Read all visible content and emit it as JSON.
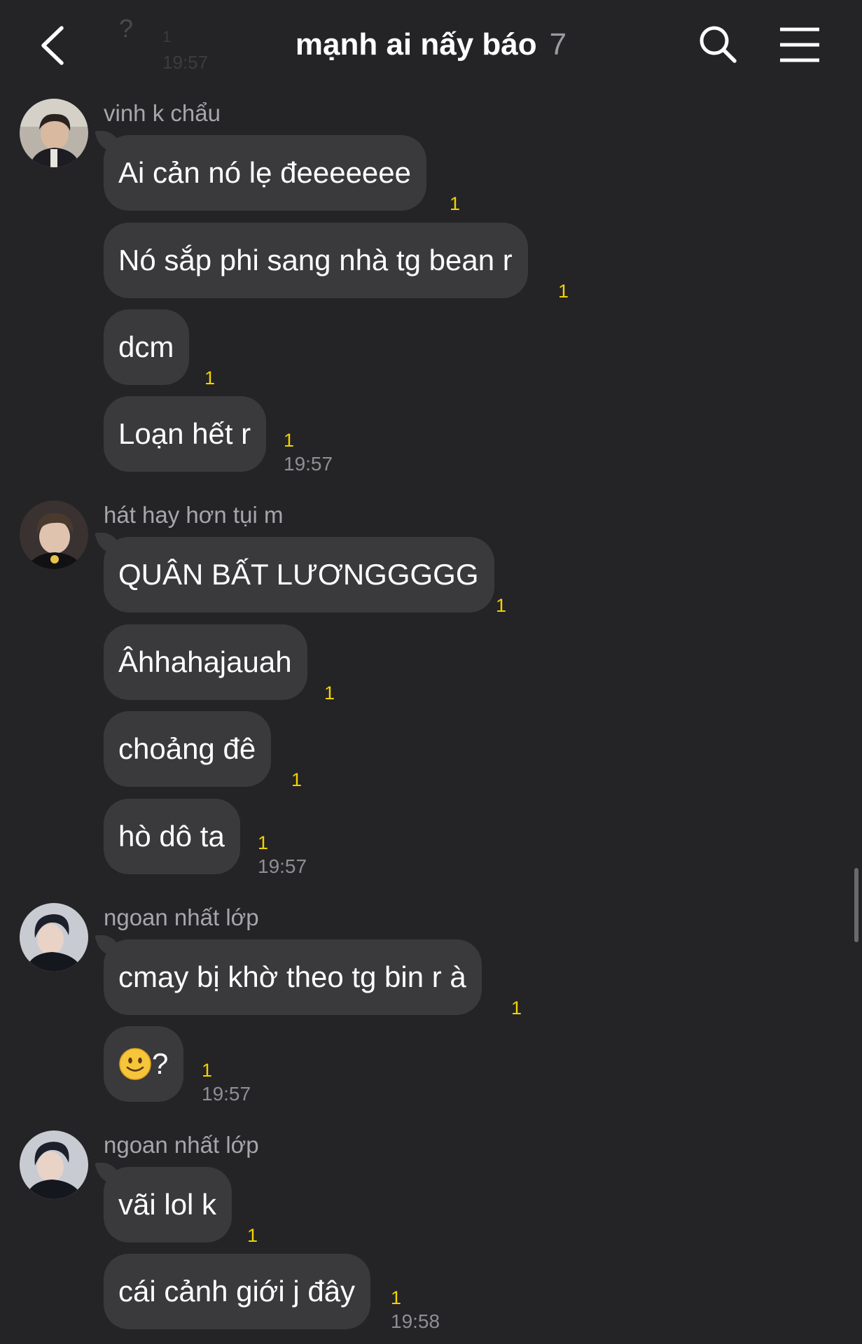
{
  "header": {
    "title": "mạnh ai nấy báo",
    "member_count": "7",
    "ghost_text": "?",
    "ghost_count": "1",
    "ghost_time": "19:57"
  },
  "colors": {
    "background": "#242426",
    "bubble": "#3a3a3d",
    "unread_count": "#f2d200",
    "timestamp": "#8e8e93",
    "sender_name": "#a6a6ab"
  },
  "groups": [
    {
      "sender": "vinh k chẩu",
      "messages": [
        {
          "text": "Ai cản nó lẹ đeeeeeee",
          "count": "1"
        },
        {
          "text": "Nó sắp phi sang nhà tg bean r",
          "count": "1"
        },
        {
          "text": "dcm",
          "count": "1"
        },
        {
          "text": "Loạn hết r",
          "count": "1",
          "time": "19:57"
        }
      ]
    },
    {
      "sender": "hát hay hơn tụi m",
      "messages": [
        {
          "text": "QUÂN BẤT LƯƠNGGGGG",
          "count": "1"
        },
        {
          "text": "Âhhahajauah",
          "count": "1"
        },
        {
          "text": "choảng đê",
          "count": "1"
        },
        {
          "text": "hò dô ta",
          "count": "1",
          "time": "19:57"
        }
      ]
    },
    {
      "sender": "ngoan nhất lớp",
      "messages": [
        {
          "text": "cmay bị khờ theo tg bin r à",
          "count": "1"
        },
        {
          "text": "?",
          "emoji": "slightly-smiling-face",
          "count": "1",
          "time": "19:57"
        }
      ]
    },
    {
      "sender": "ngoan nhất lớp",
      "messages": [
        {
          "text": "vãi lol k",
          "count": "1"
        },
        {
          "text": "cái cảnh giới j đây",
          "count": "1",
          "time": "19:58"
        }
      ]
    }
  ]
}
